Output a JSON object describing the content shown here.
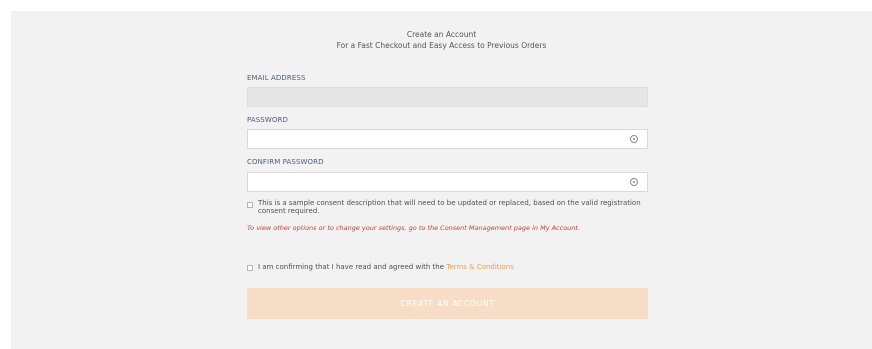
{
  "header": {
    "title": "Create an Account",
    "subtitle": "For a Fast Checkout and Easy Access to Previous Orders"
  },
  "form": {
    "email": {
      "label": "EMAIL ADDRESS",
      "value": ""
    },
    "password": {
      "label": "PASSWORD",
      "value": ""
    },
    "confirm_password": {
      "label": "CONFIRM PASSWORD",
      "value": ""
    },
    "consent": {
      "text": "This is a sample consent description that will need to be updated or replaced, based on the valid registration consent required.",
      "checked": false
    },
    "consent_note": "To view other options or to change your settings, go to the Consent Management page in My Account.",
    "terms": {
      "prefix": "I am confirming that I have read and agreed with the",
      "link_label": "Terms & Conditions",
      "checked": false
    },
    "submit_label": "CREATE AN ACCOUNT"
  },
  "colors": {
    "panel_background": "#f2f2f2",
    "link_accent": "#e8a057",
    "note_red": "#c0423b",
    "submit_disabled_bg": "#f7dcc6"
  },
  "icons": [
    "eye-icon",
    "eye-icon"
  ]
}
